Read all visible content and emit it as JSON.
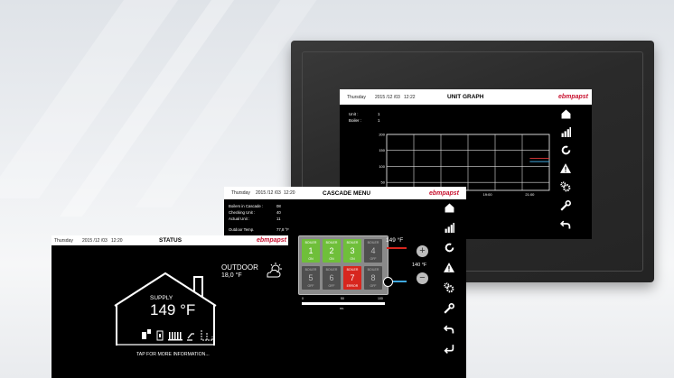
{
  "brand": "ebmpapst",
  "unit_graph_screen": {
    "header": {
      "day": "Thursday",
      "date": "2015 /12 /03",
      "time": "12:22",
      "title": "UNIT GRAPH"
    },
    "info": [
      {
        "label": "Unit :",
        "value": "1"
      },
      {
        "label": "Boiler :",
        "value": "1"
      }
    ],
    "chart_data": {
      "type": "line",
      "y_ticks": [
        "200",
        "150",
        "100",
        "50"
      ],
      "x_ticks": [
        "19:00",
        "21:00"
      ],
      "grid": true,
      "series": [
        {
          "color": "#e23a3a",
          "values": [
            125,
            125
          ]
        },
        {
          "color": "#3fa9e0",
          "values": [
            115,
            115
          ]
        }
      ]
    }
  },
  "cascade_screen": {
    "header": {
      "day": "Thursday",
      "date": "2015 /12 /03",
      "time": "12:20",
      "title": "CASCADE MENU"
    },
    "info": [
      {
        "label": "Boilers in Cascade :",
        "value": "08"
      },
      {
        "label": "Checking Unit :",
        "value": "40"
      },
      {
        "label": "Actual Unit :",
        "value": "11"
      }
    ],
    "outdoor": {
      "label": "Outdoor Temp.",
      "value": "77,8 °F"
    },
    "boilers": [
      {
        "label": "BOILER",
        "num": "1",
        "state": "ON",
        "status": "green"
      },
      {
        "label": "BOILER",
        "num": "2",
        "state": "ON",
        "status": "green"
      },
      {
        "label": "BOILER",
        "num": "3",
        "state": "ON",
        "status": "green"
      },
      {
        "label": "BOILER",
        "num": "4",
        "state": "OFF",
        "status": "gray"
      },
      {
        "label": "BOILER",
        "num": "5",
        "state": "OFF",
        "status": "gray"
      },
      {
        "label": "BOILER",
        "num": "6",
        "state": "OFF",
        "status": "gray"
      },
      {
        "label": "BOILER",
        "num": "7",
        "state": "ERROR",
        "status": "red"
      },
      {
        "label": "BOILER",
        "num": "8",
        "state": "OFF",
        "status": "gray"
      }
    ],
    "temp_actual": "149 °F",
    "temp_set": "140 °F",
    "progress": {
      "min": "0",
      "mid": "50",
      "max": "100",
      "unit": "0%",
      "value": 0
    }
  },
  "status_screen": {
    "header": {
      "day": "Thursday",
      "date": "2015 /12 /03",
      "time": "12:20",
      "title": "STATUS"
    },
    "outdoor_label": "OUTDOOR",
    "outdoor_value": "18,0 °F",
    "supply_label": "SUPPLY",
    "supply_value": "149 °F",
    "tap_text": "TAP FOR MORE INFORMATION..."
  },
  "colors": {
    "accent_red": "#c8102e",
    "on_green": "#6fbf3a",
    "error_red": "#d7261e"
  }
}
